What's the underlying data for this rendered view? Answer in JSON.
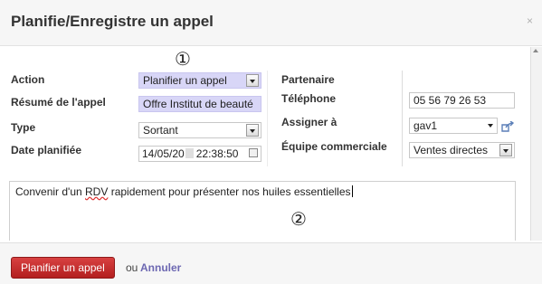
{
  "dialog": {
    "title": "Planifie/Enregistre un appel",
    "close_symbol": "×"
  },
  "markers": {
    "one": "①",
    "two": "②"
  },
  "left_form": {
    "action": {
      "label": "Action",
      "value": "Planifier un appel"
    },
    "summary": {
      "label": "Résumé de l'appel",
      "value": "Offre Institut de beauté"
    },
    "type": {
      "label": "Type",
      "value": "Sortant"
    },
    "date": {
      "label": "Date planifiée",
      "value": "14/05/20",
      "time": "22:38:50"
    }
  },
  "right_form": {
    "partner": {
      "label": "Partenaire"
    },
    "phone": {
      "label": "Téléphone",
      "value": "05 56 79 26 53"
    },
    "assign": {
      "label": "Assigner à",
      "value": "gav1"
    },
    "sales_team": {
      "label": "Équipe commerciale",
      "value": "Ventes directes"
    }
  },
  "notes": {
    "before": "Convenir d'un ",
    "rdv": "RDV",
    "after": " rapidement pour présenter nos huiles essentielles"
  },
  "footer": {
    "primary_label": "Planifier un appel",
    "or_label": "ou",
    "cancel_label": "Annuler"
  },
  "colors": {
    "primary_button": "#c0392b",
    "highlight_field": "#d8d6f7",
    "cancel_link": "#6d68b2"
  }
}
